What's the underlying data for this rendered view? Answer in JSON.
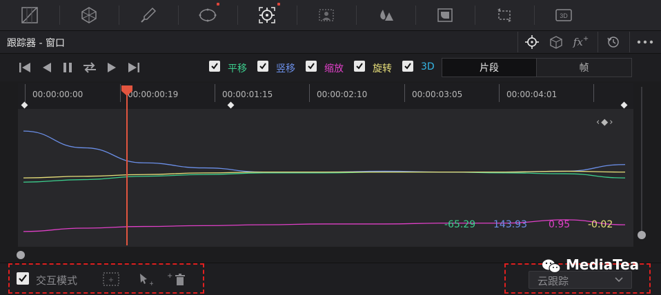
{
  "toolbar": {
    "tools": [
      {
        "icon": "curves-icon"
      },
      {
        "icon": "color-warper-icon"
      },
      {
        "icon": "qualifier-eyedropper-icon"
      },
      {
        "icon": "power-window-icon"
      },
      {
        "icon": "tracker-icon"
      },
      {
        "icon": "magic-mask-icon"
      },
      {
        "icon": "blur-icon"
      },
      {
        "icon": "key-icon"
      },
      {
        "icon": "sizing-icon"
      },
      {
        "icon": "3d-icon",
        "text": "3D"
      }
    ]
  },
  "header": {
    "title": "跟踪器 - 窗口"
  },
  "controls": {
    "checkboxes": [
      {
        "label": "平移",
        "checked": true,
        "color": "#3ccf8e"
      },
      {
        "label": "竖移",
        "checked": true,
        "color": "#6b8fe8"
      },
      {
        "label": "缩放",
        "checked": true,
        "color": "#e040c8"
      },
      {
        "label": "旋转",
        "checked": true,
        "color": "#e8e07a"
      },
      {
        "label": "3D",
        "checked": true,
        "color": "#35b7e6"
      }
    ],
    "segment": {
      "options": [
        "片段",
        "帧"
      ],
      "selected": "片段"
    }
  },
  "timeline": {
    "timecodes": [
      "00:00:00:00",
      "00:00:00:19",
      "00:00:01:15",
      "00:00:02:10",
      "00:00:03:05",
      "00:00:04:01"
    ]
  },
  "chart_data": {
    "type": "line",
    "series": [
      {
        "color": "#3ccf8e",
        "values": [
          -0.55,
          -0.4,
          -0.2,
          -0.1,
          0.0,
          0.0,
          0.05,
          0.05,
          0.0,
          -0.05,
          -0.3
        ]
      },
      {
        "color": "#6b8fe8",
        "values": [
          2.5,
          1.5,
          0.6,
          0.3,
          0.05,
          0.05,
          0.1,
          0.05,
          0.05,
          0.1,
          0.5
        ]
      },
      {
        "color": "#e040c8",
        "values": [
          -3.5,
          -3.3,
          -3.2,
          -3.15,
          -3.1,
          -3.05,
          -3.05,
          -3.0,
          -3.0,
          -2.8,
          -3.1
        ]
      },
      {
        "color": "#e8e07a",
        "values": [
          -0.3,
          -0.2,
          -0.1,
          0.0,
          0.05,
          0.05,
          0.05,
          0.05,
          0.05,
          0.1,
          0.05
        ]
      }
    ],
    "readouts": [
      {
        "value": "-65.29",
        "color": "#3ccf8e"
      },
      {
        "value": "143.93",
        "color": "#6b8fe8"
      },
      {
        "value": "0.95",
        "color": "#e040c8"
      },
      {
        "value": "-0.02",
        "color": "#e8e07a"
      }
    ],
    "ylim": [
      -4,
      3
    ],
    "playhead_timecode": "00:00:00:19"
  },
  "footer": {
    "interactive_mode_label": "交互模式",
    "interactive_mode_checked": true,
    "cloud_track_label": "云跟踪"
  },
  "watermark": {
    "text": "MediaTea"
  }
}
